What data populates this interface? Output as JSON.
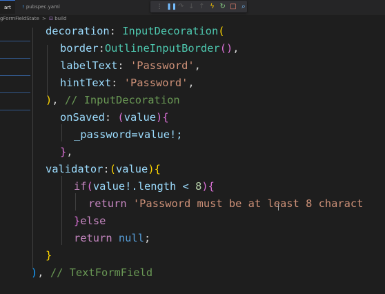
{
  "tabs": [
    {
      "icon": "dart-file-icon",
      "label": "art"
    },
    {
      "icon": "yaml-file-icon",
      "label": "pubspec.yaml"
    }
  ],
  "breadcrumb": {
    "item1": "gFormFieldState",
    "separator": ">",
    "item2": "build"
  },
  "debug_toolbar": [
    "drag-handle-icon",
    "pause-icon",
    "step-over-icon",
    "step-into-icon",
    "step-out-icon",
    "hot-reload-icon",
    "restart-icon",
    "stop-icon",
    "devtools-icon"
  ],
  "code": {
    "line1": {
      "prop": "decoration",
      "colon": ": ",
      "cls": "InputDecoration",
      "paren": "("
    },
    "line2": {
      "prop": "border",
      "colon": ":",
      "cls": "OutlineInputBorder",
      "parens": "()",
      "comma": ","
    },
    "line3": {
      "prop": "labelText",
      "colon": ": ",
      "str": "'Password'",
      "comma": ","
    },
    "line4": {
      "prop": "hintText",
      "colon": ": ",
      "str": "'Password'",
      "comma": ","
    },
    "line5": {
      "paren": ")",
      "comma": ",",
      "comment": " // InputDecoration"
    },
    "line6": {
      "prop": "onSaved",
      "colon": ": ",
      "paren": "(",
      "param": "value",
      "paren_close": ")",
      "brace": "{"
    },
    "line7": {
      "text": "_password=value!;"
    },
    "line8": {
      "brace": "}",
      "comma": ","
    },
    "line9": {
      "prop": "validator",
      "colon": ":",
      "paren": "(",
      "param": "value",
      "paren_close": ")",
      "brace": "{"
    },
    "line10": {
      "kw": "if",
      "paren": "(",
      "expr": "value!.length < ",
      "num": "8",
      "paren_close": ")",
      "brace": "{"
    },
    "line11": {
      "kw": "return",
      "space": " ",
      "str": "'Password must be at least 8 charact"
    },
    "line12": {
      "brace": "}",
      "kw": "else"
    },
    "line13": {
      "kw": "return",
      "space": " ",
      "null": "null",
      "semi": ";"
    },
    "line14": {
      "brace": "}"
    },
    "line15": {
      "paren": ")",
      "comma": ",",
      "comment": " // TextFormField"
    }
  },
  "colors": {
    "editor_bg": "#1e1e1e",
    "keyword": "#569cd6",
    "control": "#c586c0",
    "class": "#4ec9b0",
    "property": "#9cdcfe",
    "string": "#ce9178",
    "number": "#b5cea8",
    "comment": "#6a9955"
  }
}
